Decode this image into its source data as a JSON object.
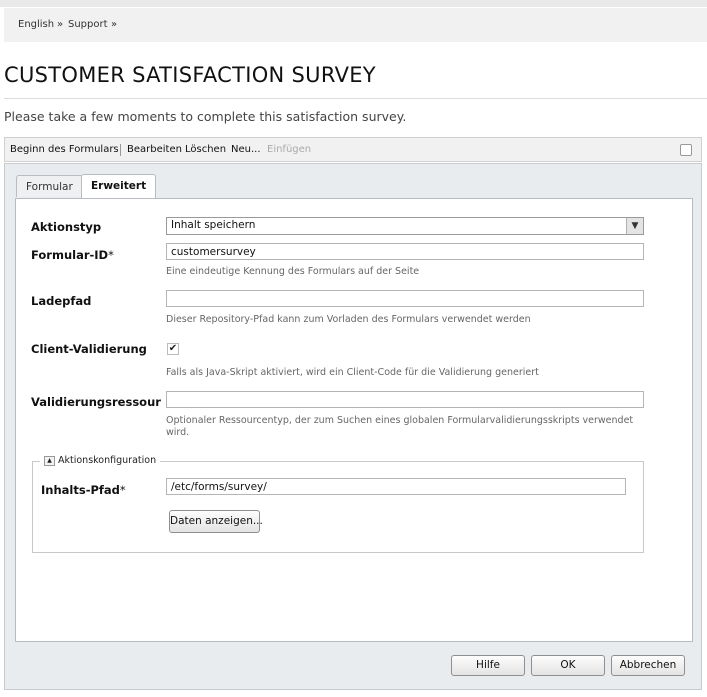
{
  "breadcrumb": [
    "English",
    "»",
    "Support",
    "»"
  ],
  "page": {
    "title": "CUSTOMER SATISFACTION SURVEY",
    "lead": "Please take a few moments to complete this satisfaction survey."
  },
  "editbar": {
    "start": "Beginn des Formulars",
    "edit": "Bearbeiten",
    "delete": "Löschen",
    "new": "Neu...",
    "insert": "Einfügen"
  },
  "tabs": [
    {
      "label": "Formular",
      "active": false
    },
    {
      "label": "Erweitert",
      "active": true
    }
  ],
  "form": {
    "action_type": {
      "label": "Aktionstyp",
      "value": "Inhalt speichern"
    },
    "form_id": {
      "label": "Formular-ID",
      "required": "*",
      "value": "customersurvey",
      "help": "Eine eindeutige Kennung des Formulars auf der Seite"
    },
    "load_path": {
      "label": "Ladepfad",
      "value": "",
      "help": "Dieser Repository-Pfad kann zum Vorladen des Formulars verwendet werden"
    },
    "client_validation": {
      "label": "Client-Validierung",
      "checked": true,
      "check_glyph": "✔",
      "help": "Falls als Java-Skript aktiviert, wird ein Client-Code für die Validierung generiert"
    },
    "validation_resource": {
      "label": "Validierungsressource",
      "value": "",
      "help": "Optionaler Ressourcentyp, der zum Suchen eines globalen Formularvalidierungsskripts verwendet wird."
    },
    "action_config": {
      "legend": "Aktionskonfiguration",
      "toggle_glyph": "▲",
      "content_path": {
        "label": "Inhalts-Pfad",
        "required": "*",
        "value": "/etc/forms/survey/"
      },
      "view_data_label": "Daten anzeigen..."
    }
  },
  "footer": {
    "help_label": "Hilfe",
    "ok_label": "OK",
    "cancel_label": "Abbrechen"
  },
  "colors": {
    "panel_bg": "#e9ecef",
    "bar_bg": "#f1f1f1"
  }
}
